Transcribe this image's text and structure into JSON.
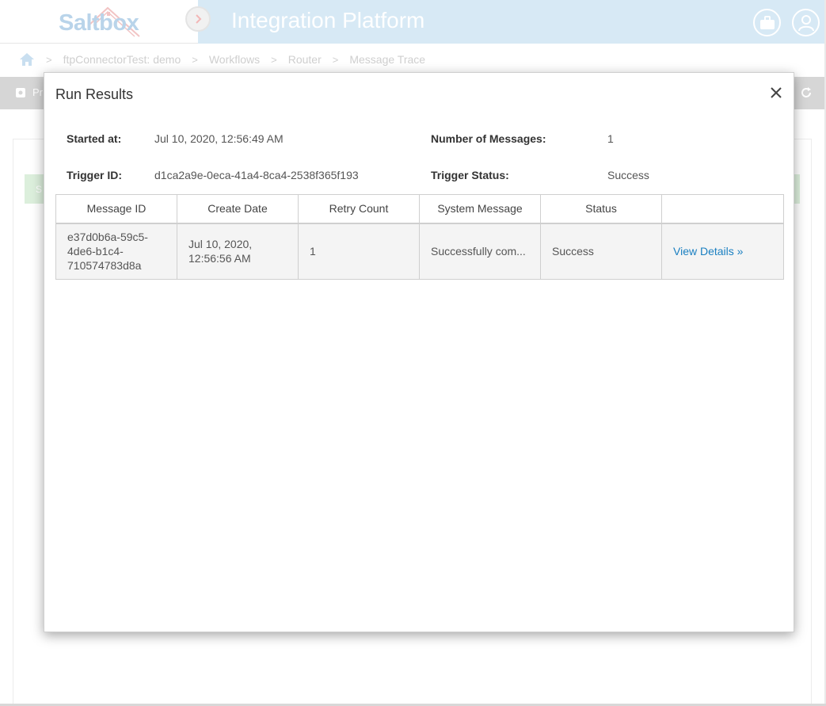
{
  "header": {
    "logo_text": "Saltbox",
    "title": "Integration Platform",
    "toggle_icon": "chevron-right-icon",
    "icons": [
      "briefcase-icon",
      "user-icon"
    ]
  },
  "breadcrumb": {
    "items": [
      "ftpConnectorTest: demo",
      "Workflows",
      "Router",
      "Message Trace"
    ]
  },
  "toolbar": {
    "left_label": "Pr"
  },
  "background": {
    "green_left_text": "S"
  },
  "modal": {
    "title": "Run Results",
    "fields": {
      "started_at_label": "Started at:",
      "started_at_value": "Jul 10, 2020, 12:56:49 AM",
      "num_messages_label": "Number of Messages:",
      "num_messages_value": "1",
      "trigger_id_label": "Trigger ID:",
      "trigger_id_value": "d1ca2a9e-0eca-41a4-8ca4-2538f365f193",
      "trigger_status_label": "Trigger Status:",
      "trigger_status_value": "Success"
    },
    "table": {
      "columns": [
        "Message ID",
        "Create Date",
        "Retry Count",
        "System Message",
        "Status",
        ""
      ],
      "rows": [
        {
          "message_id_1": "e37d0b6a-59c5-",
          "message_id_2": "4de6-b1c4-",
          "message_id_3": "710574783d8a",
          "create_date_1": "Jul 10, 2020,",
          "create_date_2": "12:56:56 AM",
          "retry_count": "1",
          "system_message": "Successfully com...",
          "status": "Success",
          "action": "View Details »"
        }
      ]
    }
  },
  "colors": {
    "header_band": "#d7e9f5",
    "success": "#5cb85c",
    "link": "#1a7fc1"
  }
}
